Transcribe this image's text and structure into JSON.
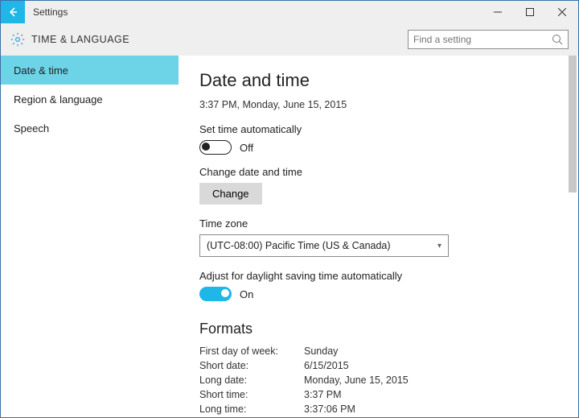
{
  "window": {
    "title": "Settings"
  },
  "header": {
    "category": "TIME & LANGUAGE",
    "search_placeholder": "Find a setting"
  },
  "sidebar": {
    "items": [
      {
        "label": "Date & time",
        "active": true
      },
      {
        "label": "Region & language",
        "active": false
      },
      {
        "label": "Speech",
        "active": false
      }
    ]
  },
  "main": {
    "heading": "Date and time",
    "current_time": "3:37 PM, Monday, June 15, 2015",
    "auto_time": {
      "label": "Set time automatically",
      "on": false,
      "state_text": "Off"
    },
    "change": {
      "label": "Change date and time",
      "button": "Change"
    },
    "timezone": {
      "label": "Time zone",
      "selected": "(UTC-08:00) Pacific Time (US & Canada)"
    },
    "dst": {
      "label": "Adjust for daylight saving time automatically",
      "on": true,
      "state_text": "On"
    },
    "formats": {
      "heading": "Formats",
      "rows": [
        {
          "k": "First day of week:",
          "v": "Sunday"
        },
        {
          "k": "Short date:",
          "v": "6/15/2015"
        },
        {
          "k": "Long date:",
          "v": "Monday, June 15, 2015"
        },
        {
          "k": "Short time:",
          "v": "3:37 PM"
        },
        {
          "k": "Long time:",
          "v": "3:37:06 PM"
        }
      ]
    }
  }
}
